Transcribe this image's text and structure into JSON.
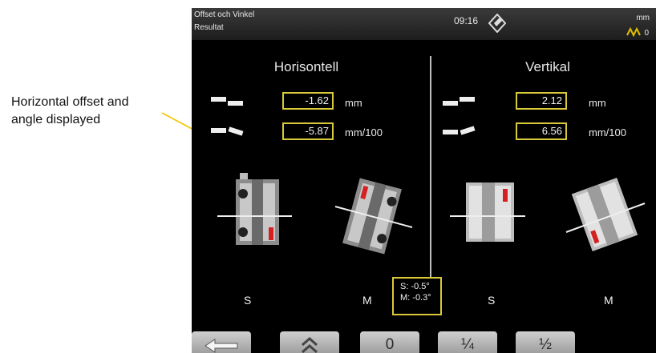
{
  "annotation_left": {
    "line1": "Horizontal offset and",
    "line2": "angle displayed"
  },
  "titlebar": {
    "title": "Offset och Vinkel",
    "subtitle": "Resultat",
    "time": "09:16",
    "unit": "mm",
    "wave_value": "0"
  },
  "horizontal": {
    "heading": "Horisontell",
    "offset_value": "-1.62",
    "offset_unit": "mm",
    "angle_value": "-5.87",
    "angle_unit": "mm/100",
    "s_label": "S",
    "m_label": "M"
  },
  "vertical": {
    "heading": "Vertikal",
    "offset_value": "2.12",
    "offset_unit": "mm",
    "angle_value": "6.56",
    "angle_unit": "mm/100",
    "s_label": "S",
    "m_label": "M"
  },
  "angle_box": {
    "s_line": "S: -0.5°",
    "m_line": "M: -0.3°"
  },
  "buttons": [
    {
      "label": "",
      "icon": "arrow-left-icon"
    },
    {
      "label": "",
      "icon": "chevron-up-double-icon"
    },
    {
      "label": "0"
    },
    {
      "label": "¼"
    },
    {
      "label": "½"
    }
  ],
  "colors": {
    "accent": "#d9c93a",
    "leader_line": "#f2c500",
    "marker_red": "#d42020"
  }
}
